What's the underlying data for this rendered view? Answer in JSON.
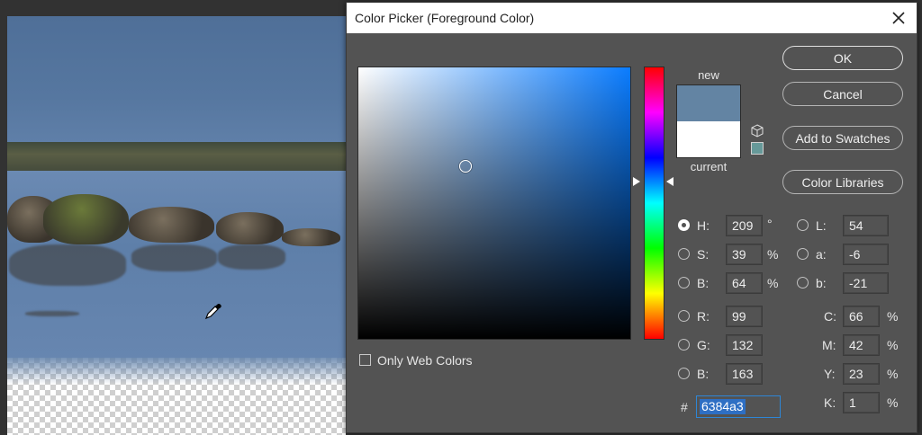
{
  "dialog": {
    "title": "Color Picker (Foreground Color)",
    "close_icon": "close-icon"
  },
  "swatch": {
    "new_label": "new",
    "current_label": "current",
    "new_color": "#6384a3",
    "current_color": "#ffffff"
  },
  "buttons": {
    "ok": "OK",
    "cancel": "Cancel",
    "add_to_swatches": "Add to Swatches",
    "color_libraries": "Color Libraries"
  },
  "hsb": {
    "h": {
      "label": "H:",
      "value": "209",
      "unit": "°",
      "selected": true
    },
    "s": {
      "label": "S:",
      "value": "39",
      "unit": "%"
    },
    "b": {
      "label": "B:",
      "value": "64",
      "unit": "%"
    }
  },
  "rgb": {
    "r": {
      "label": "R:",
      "value": "99"
    },
    "g": {
      "label": "G:",
      "value": "132"
    },
    "b": {
      "label": "B:",
      "value": "163"
    }
  },
  "lab": {
    "l": {
      "label": "L:",
      "value": "54"
    },
    "a": {
      "label": "a:",
      "value": "-6"
    },
    "b": {
      "label": "b:",
      "value": "-21"
    }
  },
  "cmyk": {
    "c": {
      "label": "C:",
      "value": "66",
      "unit": "%"
    },
    "m": {
      "label": "M:",
      "value": "42",
      "unit": "%"
    },
    "y": {
      "label": "Y:",
      "value": "23",
      "unit": "%"
    },
    "k": {
      "label": "K:",
      "value": "1",
      "unit": "%"
    }
  },
  "hex": {
    "hash": "#",
    "value": "6384a3"
  },
  "only_web_colors": {
    "label": "Only Web Colors",
    "checked": false
  },
  "colors": {
    "dialog_bg": "#535353",
    "accent": "#2e86d6"
  }
}
